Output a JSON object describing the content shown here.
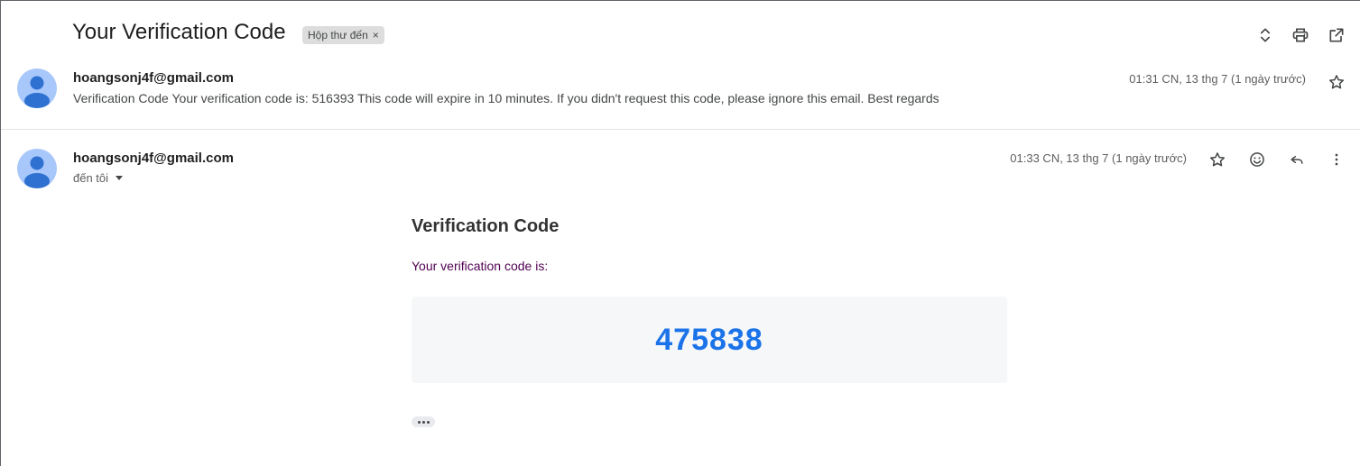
{
  "thread": {
    "subject": "Your Verification Code",
    "label": "Hộp thư đến",
    "label_remove": "×"
  },
  "top_actions": {
    "expand_icon": "unfold-icon",
    "print_icon": "print-icon",
    "open_new_window_icon": "open-in-new-icon"
  },
  "messages": [
    {
      "sender": "hoangsonj4f@gmail.com",
      "snippet": "Verification Code Your verification code is: 516393 This code will expire in 10 minutes. If you didn't request this code, please ignore this email. Best regards",
      "timestamp": "01:31 CN, 13 thg 7 (1 ngày trước)",
      "star_icon": "star-icon"
    },
    {
      "sender": "hoangsonj4f@gmail.com",
      "to": "đến tôi",
      "timestamp": "01:33 CN, 13 thg 7 (1 ngày trước)",
      "actions": [
        "star-icon",
        "emoji-icon",
        "reply-icon",
        "more-vert-icon"
      ],
      "body": {
        "heading": "Verification Code",
        "text": "Your verification code is:",
        "code": "475838"
      }
    }
  ],
  "colors": {
    "code": "#1a73e8",
    "body_text": "#500050",
    "code_box_bg": "#f6f7f9",
    "avatar_bg": "#a8c7fa",
    "avatar_fg": "#1a62c9"
  }
}
